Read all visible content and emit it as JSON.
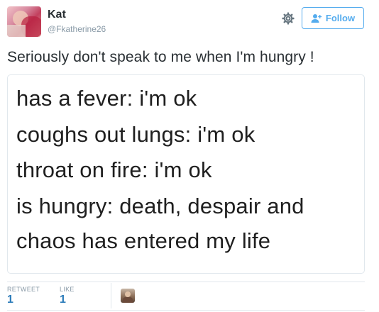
{
  "user": {
    "name": "Kat",
    "handle": "@Fkatherine26"
  },
  "header": {
    "follow_label": "Follow",
    "gear_icon": "gear-icon",
    "follow_icon": "add-user-icon",
    "accent_color": "#55acee"
  },
  "tweet": {
    "text": "Seriously don't speak to me when I'm hungry !"
  },
  "media": {
    "lines": [
      "has a fever: i'm ok",
      "coughs out lungs: i'm ok",
      "throat on fire: i'm ok",
      "is hungry: death, despair and",
      "chaos has entered my life"
    ]
  },
  "stats": {
    "retweet_label": "RETWEET",
    "retweet_count": "1",
    "like_label": "LIKE",
    "like_count": "1"
  }
}
